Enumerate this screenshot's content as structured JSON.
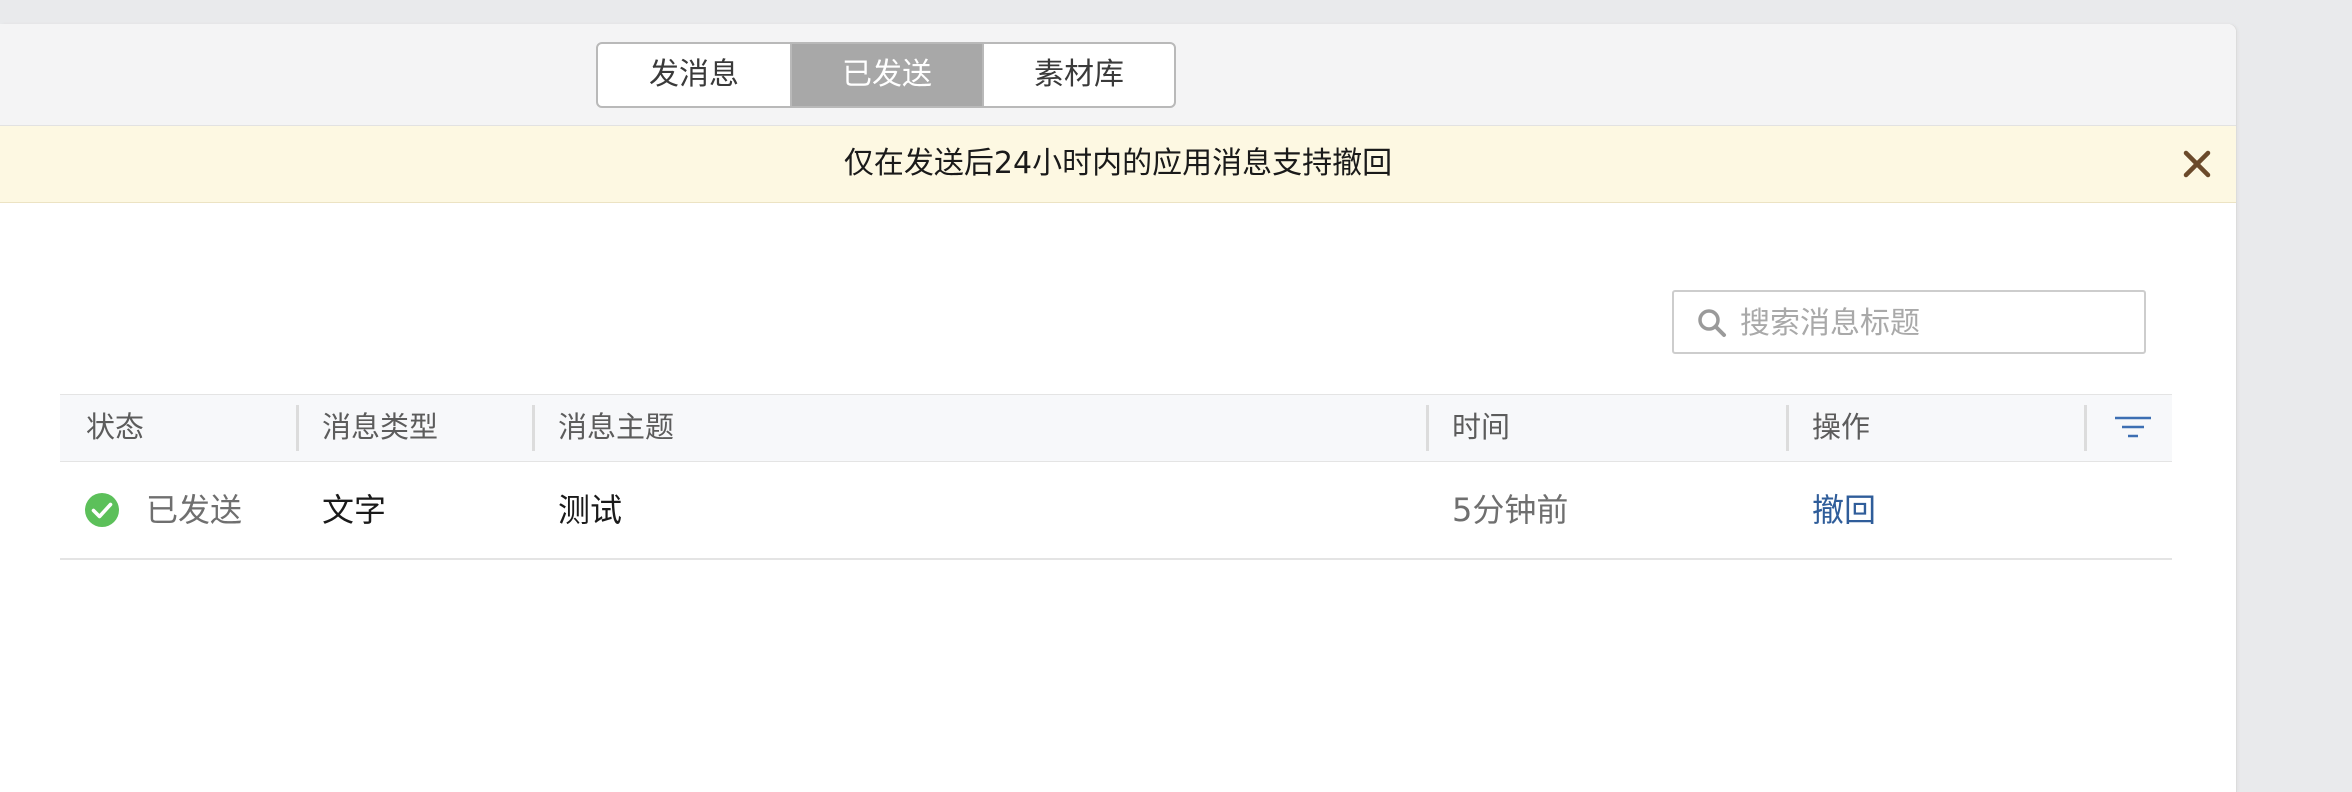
{
  "tabs": [
    {
      "label": "发消息",
      "active": false
    },
    {
      "label": "已发送",
      "active": true
    },
    {
      "label": "素材库",
      "active": false
    }
  ],
  "notice": {
    "text": "仅在发送后24小时内的应用消息支持撤回",
    "close_icon": "close-icon"
  },
  "search": {
    "placeholder": "搜索消息标题",
    "value": "",
    "icon": "search-icon"
  },
  "table": {
    "columns": [
      "状态",
      "消息类型",
      "消息主题",
      "时间",
      "操作"
    ],
    "filter_icon": "filter-icon",
    "rows": [
      {
        "status": "已发送",
        "status_icon": "check-circle-icon",
        "type": "文字",
        "subject": "测试",
        "time": "5分钟前",
        "action": "撤回"
      }
    ]
  },
  "colors": {
    "notice_bg": "#fdf8e2",
    "active_tab": "#a8a8a8",
    "success": "#5cc05a",
    "link": "#2f5d9a",
    "close": "#6b4a2a"
  }
}
